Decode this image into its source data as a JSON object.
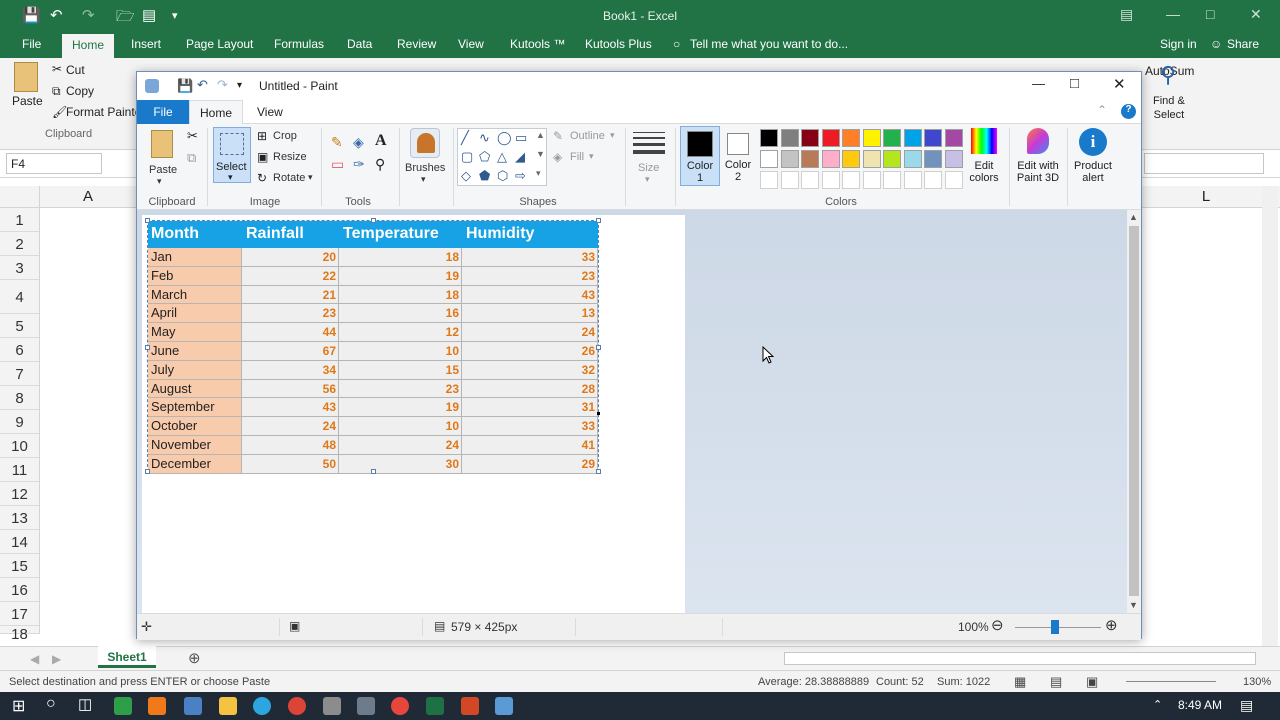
{
  "excel": {
    "title": "Book1 - Excel",
    "tabs": [
      "File",
      "Home",
      "Insert",
      "Page Layout",
      "Formulas",
      "Data",
      "Review",
      "View",
      "Kutools ™",
      "Kutools Plus"
    ],
    "tell_me": "Tell me what you want to do...",
    "sign_in": "Sign in",
    "share": "Share",
    "clipboard": {
      "paste": "Paste",
      "cut": "Cut",
      "copy": "Copy",
      "format_painter": "Format Painte",
      "group": "Clipboard"
    },
    "autosum": "AutoSum",
    "find_select": {
      "line1": "Find &",
      "line2": "Select"
    },
    "name_box": "F4",
    "col_a": "A",
    "col_l": "L",
    "rows": [
      "1",
      "2",
      "3",
      "4",
      "5",
      "6",
      "7",
      "8",
      "9",
      "10",
      "11",
      "12",
      "13",
      "14",
      "15",
      "16",
      "17",
      "18"
    ],
    "sheet_tab": "Sheet1",
    "status_left": "Select destination and press ENTER or choose Paste",
    "average": "Average: 28.38888889",
    "count": "Count: 52",
    "sum": "Sum: 1022",
    "zoom": "130%"
  },
  "paint": {
    "title": "Untitled - Paint",
    "tabs": {
      "file": "File",
      "home": "Home",
      "view": "View"
    },
    "clipboard": {
      "paste": "Paste",
      "group": "Clipboard"
    },
    "image": {
      "select": "Select",
      "crop": "Crop",
      "resize": "Resize",
      "rotate": "Rotate",
      "group": "Image"
    },
    "tools_group": "Tools",
    "brushes": "Brushes",
    "shapes": {
      "outline": "Outline",
      "fill": "Fill",
      "group": "Shapes"
    },
    "size": "Size",
    "color1": {
      "line1": "Color",
      "line2": "1"
    },
    "color2": {
      "line1": "Color",
      "line2": "2"
    },
    "colors_group": "Colors",
    "edit_colors": {
      "line1": "Edit",
      "line2": "colors"
    },
    "edit_paint3d": {
      "line1": "Edit with",
      "line2": "Paint 3D"
    },
    "product_alert": {
      "line1": "Product",
      "line2": "alert"
    },
    "palette_row1": [
      "#000000",
      "#7f7f7f",
      "#880015",
      "#ed1c24",
      "#ff7f27",
      "#fff200",
      "#22b14c",
      "#00a2e8",
      "#3f48cc",
      "#a349a4"
    ],
    "palette_row2": [
      "#ffffff",
      "#c3c3c3",
      "#b97a57",
      "#ffaec9",
      "#ffc90e",
      "#efe4b0",
      "#b5e61d",
      "#99d9ea",
      "#7092be",
      "#c8bfe7"
    ],
    "image_size": "579 × 425px",
    "zoom": "100%"
  },
  "table": {
    "headers": [
      "Month",
      "Rainfall",
      "Temperature",
      "Humidity"
    ],
    "rows": [
      [
        "Jan",
        "20",
        "18",
        "33"
      ],
      [
        "Feb",
        "22",
        "19",
        "23"
      ],
      [
        "March",
        "21",
        "18",
        "43"
      ],
      [
        "April",
        "23",
        "16",
        "13"
      ],
      [
        "May",
        "44",
        "12",
        "24"
      ],
      [
        "June",
        "67",
        "10",
        "26"
      ],
      [
        "July",
        "34",
        "15",
        "32"
      ],
      [
        "August",
        "56",
        "23",
        "28"
      ],
      [
        "September",
        "43",
        "19",
        "31"
      ],
      [
        "October",
        "24",
        "10",
        "33"
      ],
      [
        "November",
        "48",
        "24",
        "41"
      ],
      [
        "December",
        "50",
        "30",
        "29"
      ]
    ]
  },
  "taskbar": {
    "time": "8:49 AM"
  }
}
